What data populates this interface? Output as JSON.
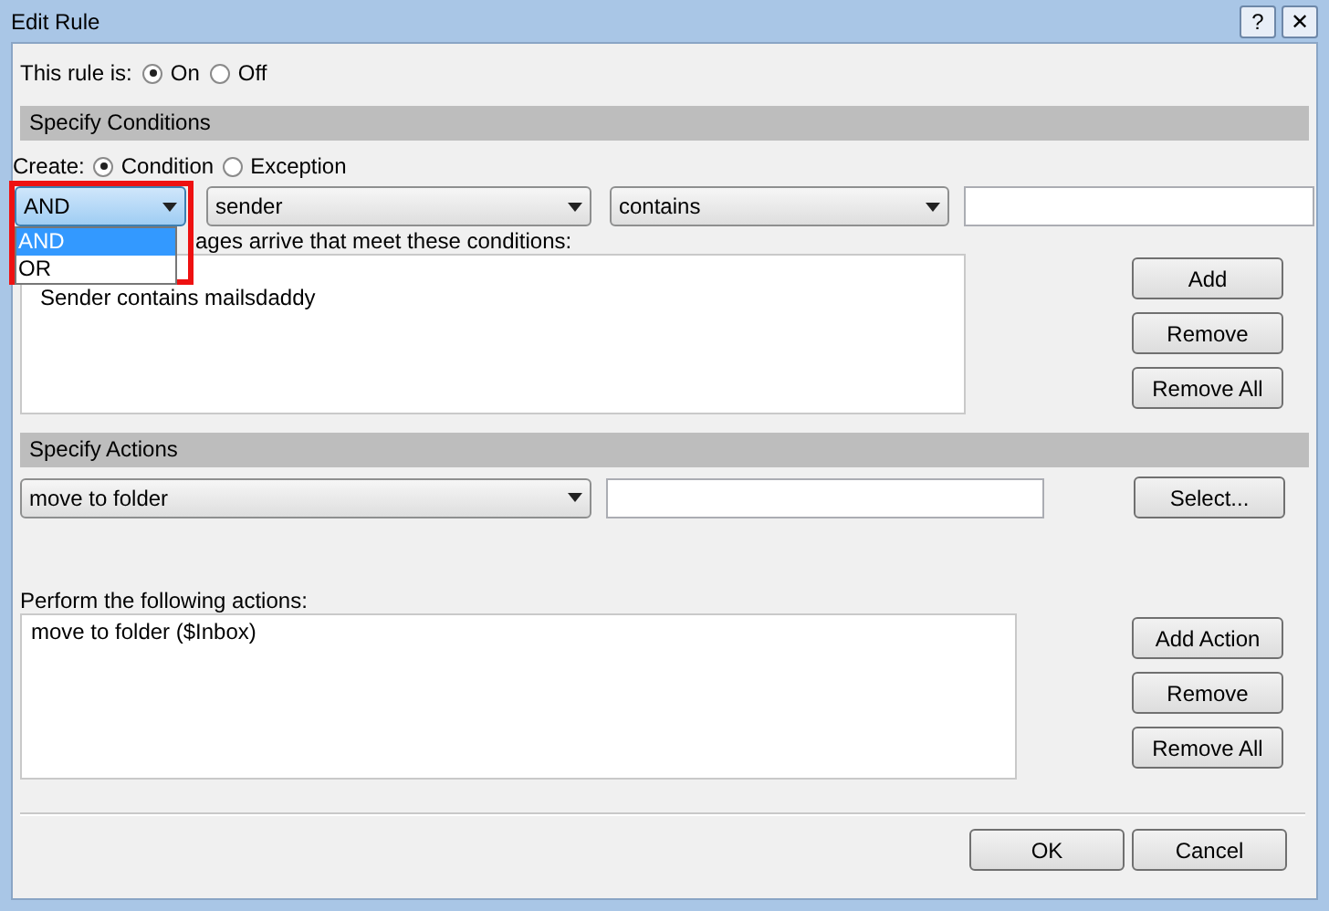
{
  "window": {
    "title": "Edit Rule",
    "help_glyph": "?",
    "close_glyph": "✕"
  },
  "rule_state": {
    "label": "This rule is:",
    "options": [
      {
        "label": "On",
        "selected": true
      },
      {
        "label": "Off",
        "selected": false
      }
    ]
  },
  "conditions": {
    "header": "Specify Conditions",
    "create_label": "Create:",
    "create_options": [
      {
        "label": "Condition",
        "selected": true
      },
      {
        "label": "Exception",
        "selected": false
      }
    ],
    "logic_select": {
      "value": "AND",
      "open": true,
      "options": [
        {
          "label": "AND",
          "selected": true
        },
        {
          "label": "OR",
          "selected": false
        }
      ]
    },
    "field_select": "sender",
    "operator_select": "contains",
    "list_label": "ages arrive that meet these conditions:",
    "items": [
      "Sender contains mailsdaddy"
    ],
    "buttons": [
      "Add",
      "Remove",
      "Remove All"
    ]
  },
  "actions": {
    "header": "Specify Actions",
    "action_select": "move to folder",
    "select_button": "Select...",
    "list_label": "Perform the following actions:",
    "items": [
      "move to folder ($Inbox)"
    ],
    "buttons": [
      "Add Action",
      "Remove",
      "Remove All"
    ]
  },
  "footer_buttons": [
    "OK",
    "Cancel"
  ]
}
